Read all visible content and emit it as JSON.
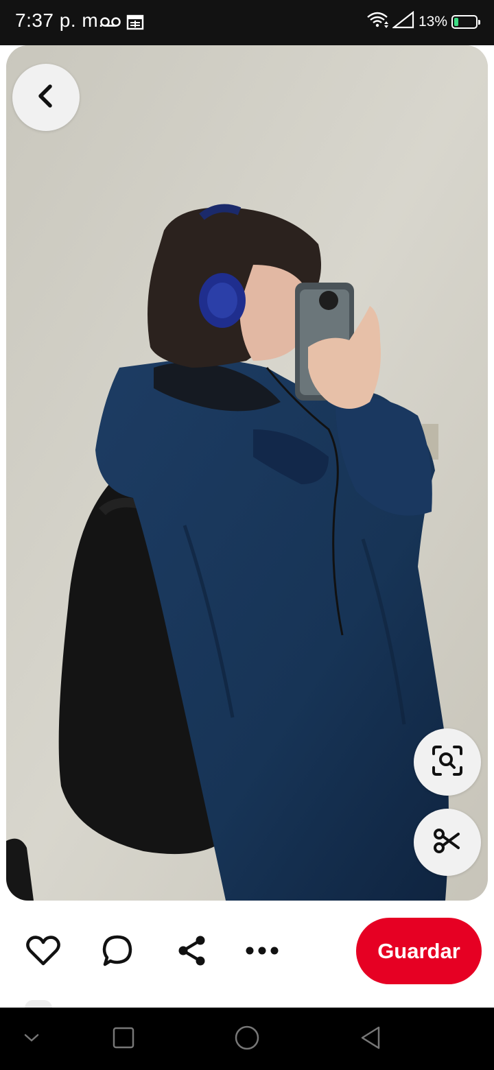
{
  "status_bar": {
    "time": "7:37 p. m.",
    "battery_percent": "13%",
    "battery_level": 0.13,
    "icons": [
      "voicemail-icon",
      "calendar-icon",
      "wifi-icon",
      "signal-icon",
      "battery-icon"
    ]
  },
  "pin": {
    "image_description_icon": "photo",
    "back_button_icon": "chevron-left-icon",
    "visual_search_icon": "visual-search-icon",
    "cutout_icon": "scissors-icon"
  },
  "actions": {
    "like_icon": "heart-icon",
    "comment_icon": "comment-icon",
    "share_icon": "share-icon",
    "more_icon": "more-icon",
    "save_label": "Guardar"
  },
  "colors": {
    "accent": "#e60023",
    "status_bar": "#121212",
    "nav_bar": "#000000"
  },
  "nav": {
    "icons": [
      "chevron-down-icon",
      "recent-apps-icon",
      "home-icon",
      "back-icon"
    ]
  }
}
